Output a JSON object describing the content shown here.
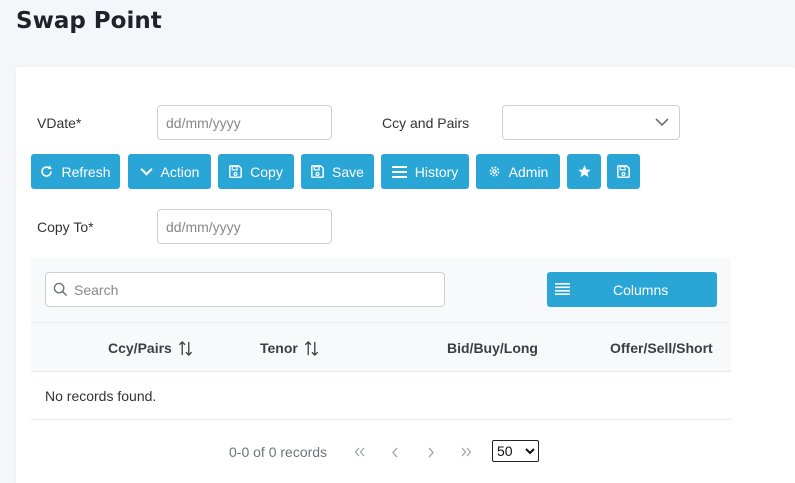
{
  "page": {
    "title": "Swap Point"
  },
  "form": {
    "vdate_label": "VDate*",
    "vdate_placeholder": "dd/mm/yyyy",
    "ccy_label": "Ccy and Pairs",
    "copyto_label": "Copy To*",
    "copyto_placeholder": "dd/mm/yyyy"
  },
  "toolbar": {
    "refresh": "Refresh",
    "action": "Action",
    "copy": "Copy",
    "save": "Save",
    "history": "History",
    "admin": "Admin",
    "accent": "#2aa6d6"
  },
  "table": {
    "search_placeholder": "Search",
    "columns_label": "Columns",
    "headers": [
      "Ccy/Pairs",
      "Tenor",
      "Bid/Buy/Long",
      "Offer/Sell/Short"
    ],
    "empty_message": "No records found.",
    "page_info": "0-0 of 0 records",
    "rows_per_page": "50"
  }
}
